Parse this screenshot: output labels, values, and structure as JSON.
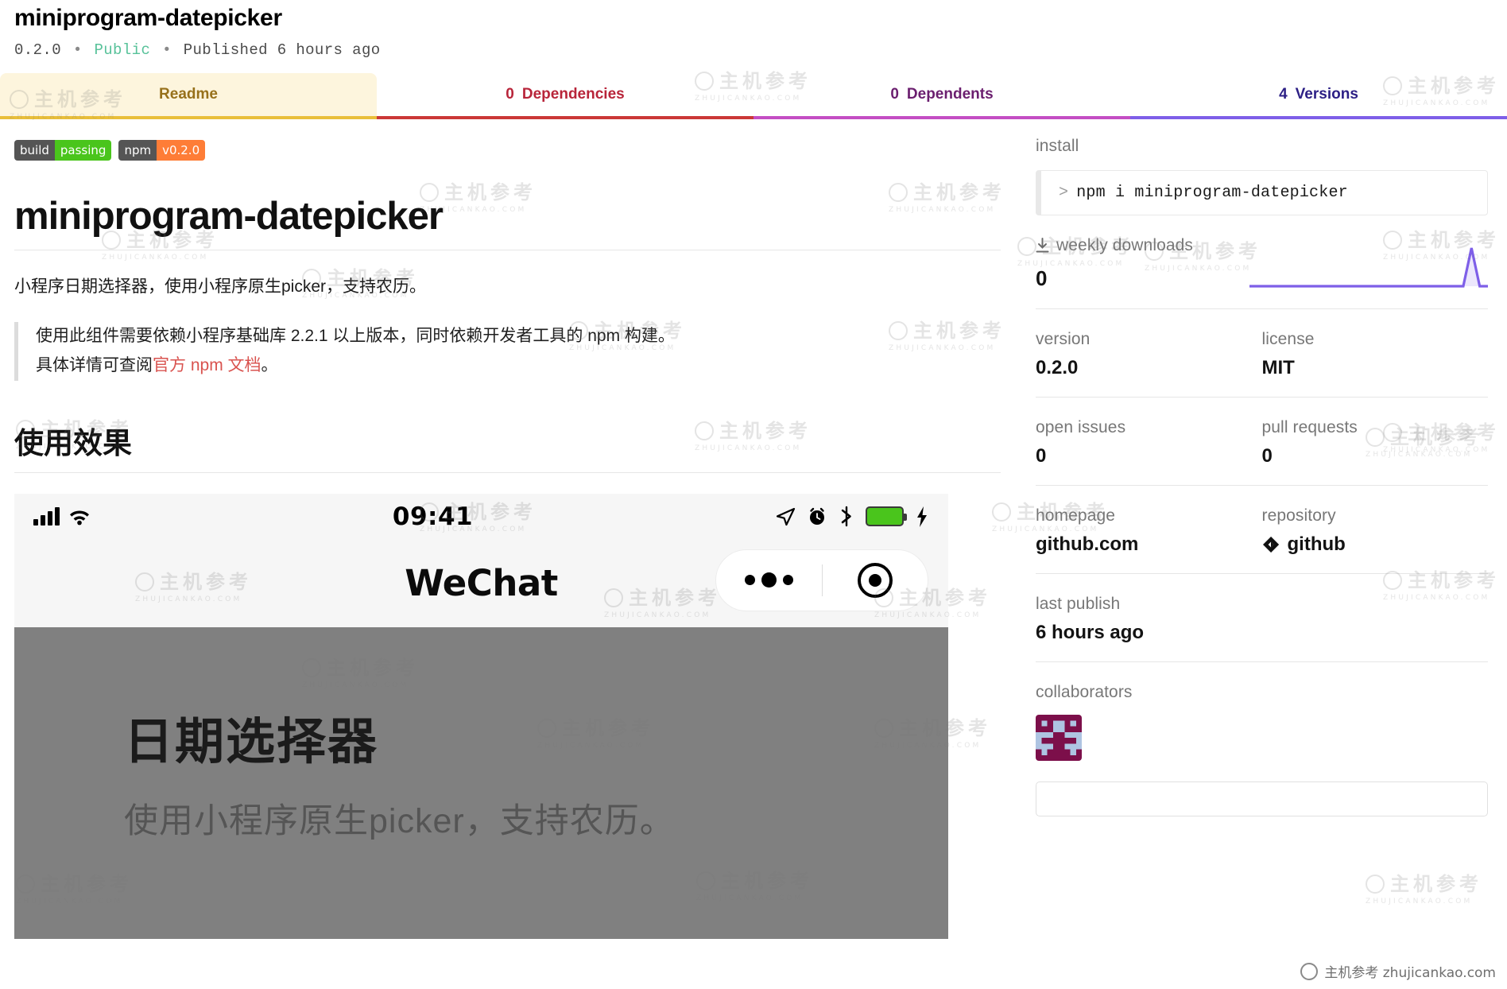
{
  "header": {
    "title": "miniprogram-datepicker",
    "version": "0.2.0",
    "visibility": "Public",
    "published": "Published 6 hours ago",
    "separator": "•"
  },
  "tabs": [
    {
      "name": "readme",
      "count": "",
      "label": "Readme",
      "active": true
    },
    {
      "name": "dependencies",
      "count": "0",
      "label": "Dependencies",
      "active": false
    },
    {
      "name": "dependents",
      "count": "0",
      "label": "Dependents",
      "active": false
    },
    {
      "name": "versions",
      "count": "4",
      "label": "Versions",
      "active": false
    }
  ],
  "badges": [
    {
      "key": "build",
      "value": "passing",
      "color": "#4ac51c"
    },
    {
      "key": "npm",
      "value": "v0.2.0",
      "color": "#fe7d37"
    }
  ],
  "readme": {
    "h1": "miniprogram-datepicker",
    "intro": "小程序日期选择器，使用小程序原生picker，支持农历。",
    "quote_line1": "使用此组件需要依赖小程序基础库 2.2.1 以上版本，同时依赖开发者工具的 npm 构建。",
    "quote_line2_pre": "具体详情可查阅",
    "quote_link": "官方 npm 文档",
    "quote_line2_post": "。",
    "h2": "使用效果"
  },
  "phone_mock": {
    "time": "09:41",
    "app_name": "WeChat",
    "screen_title": "日期选择器",
    "screen_subtitle": "使用小程序原生picker，支持农历。",
    "battery_color": "#4ac51c"
  },
  "sidebar": {
    "install_label": "install",
    "install_command": "npm i miniprogram-datepicker",
    "install_caret": ">",
    "downloads_label": "weekly downloads",
    "downloads_value": "0",
    "version_label": "version",
    "version_value": "0.2.0",
    "license_label": "license",
    "license_value": "MIT",
    "open_issues_label": "open issues",
    "open_issues_value": "0",
    "pull_requests_label": "pull requests",
    "pull_requests_value": "0",
    "homepage_label": "homepage",
    "homepage_value": "github.com",
    "repository_label": "repository",
    "repository_value": "github",
    "last_publish_label": "last publish",
    "last_publish_value": "6 hours ago",
    "collaborators_label": "collaborators",
    "accent_color": "#7e5fe8"
  },
  "chart_data": {
    "type": "line",
    "title": "weekly downloads",
    "xlabel": "",
    "ylabel": "",
    "x": [
      0,
      1,
      2,
      3,
      4,
      5,
      6,
      7,
      8,
      9,
      10,
      11,
      12,
      13,
      14,
      15,
      16,
      17,
      18,
      19,
      20,
      21,
      22,
      23,
      24,
      25,
      26,
      27,
      28,
      29
    ],
    "values": [
      0,
      0,
      0,
      0,
      0,
      0,
      0,
      0,
      0,
      0,
      0,
      0,
      0,
      0,
      0,
      0,
      0,
      0,
      0,
      0,
      0,
      0,
      0,
      0,
      0,
      0,
      0,
      1,
      0,
      0
    ],
    "ylim": [
      0,
      1
    ],
    "grid": false,
    "legend": "none",
    "line_color": "#7e5fe8",
    "fill_color": "#ece7fc"
  },
  "watermarks": {
    "cn": "主机参考",
    "en": "ZHUJICANKAO.COM",
    "corner": "主机参考 zhujicankao.com"
  }
}
